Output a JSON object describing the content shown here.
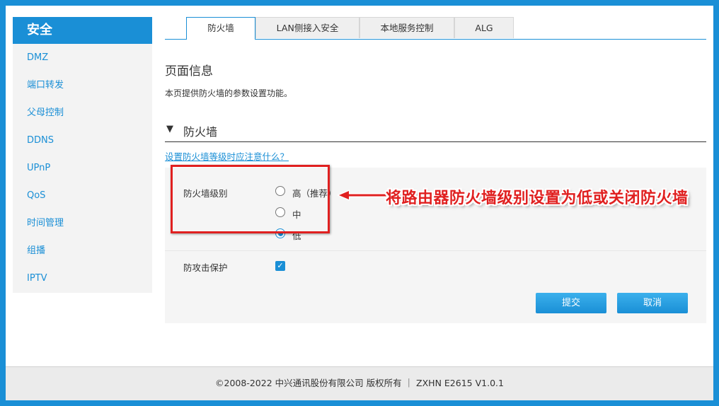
{
  "sidebar": {
    "title": "安全",
    "items": [
      {
        "label": "DMZ"
      },
      {
        "label": "端口转发"
      },
      {
        "label": "父母控制"
      },
      {
        "label": "DDNS"
      },
      {
        "label": "UPnP"
      },
      {
        "label": "QoS"
      },
      {
        "label": "时间管理"
      },
      {
        "label": "组播"
      },
      {
        "label": "IPTV"
      }
    ]
  },
  "tabs": [
    {
      "label": "防火墙",
      "active": true
    },
    {
      "label": "LAN侧接入安全",
      "active": false
    },
    {
      "label": "本地服务控制",
      "active": false
    },
    {
      "label": "ALG",
      "active": false
    }
  ],
  "page": {
    "title": "页面信息",
    "description": "本页提供防火墙的参数设置功能。"
  },
  "section": {
    "arrow": "▼",
    "title": "防火墙",
    "help_link": "设置防火墙等级时应注意什么？"
  },
  "form": {
    "level_label": "防火墙级别",
    "level_options": [
      {
        "label": "高（推荐）",
        "checked": false
      },
      {
        "label": "中",
        "checked": false
      },
      {
        "label": "低",
        "checked": true
      }
    ],
    "attack_label": "防攻击保护",
    "attack_checked": true,
    "submit_label": "提交",
    "cancel_label": "取消"
  },
  "annotation": {
    "text": "将路由器防火墙级别设置为低或关闭防火墙",
    "color": "#e02020"
  },
  "footer": {
    "text": "©2008-2022 中兴通讯股份有限公司 版权所有 ｜ ZXHN E2615 V1.0.1"
  },
  "colors": {
    "accent": "#1a8fd6",
    "annotation": "#e02020"
  }
}
